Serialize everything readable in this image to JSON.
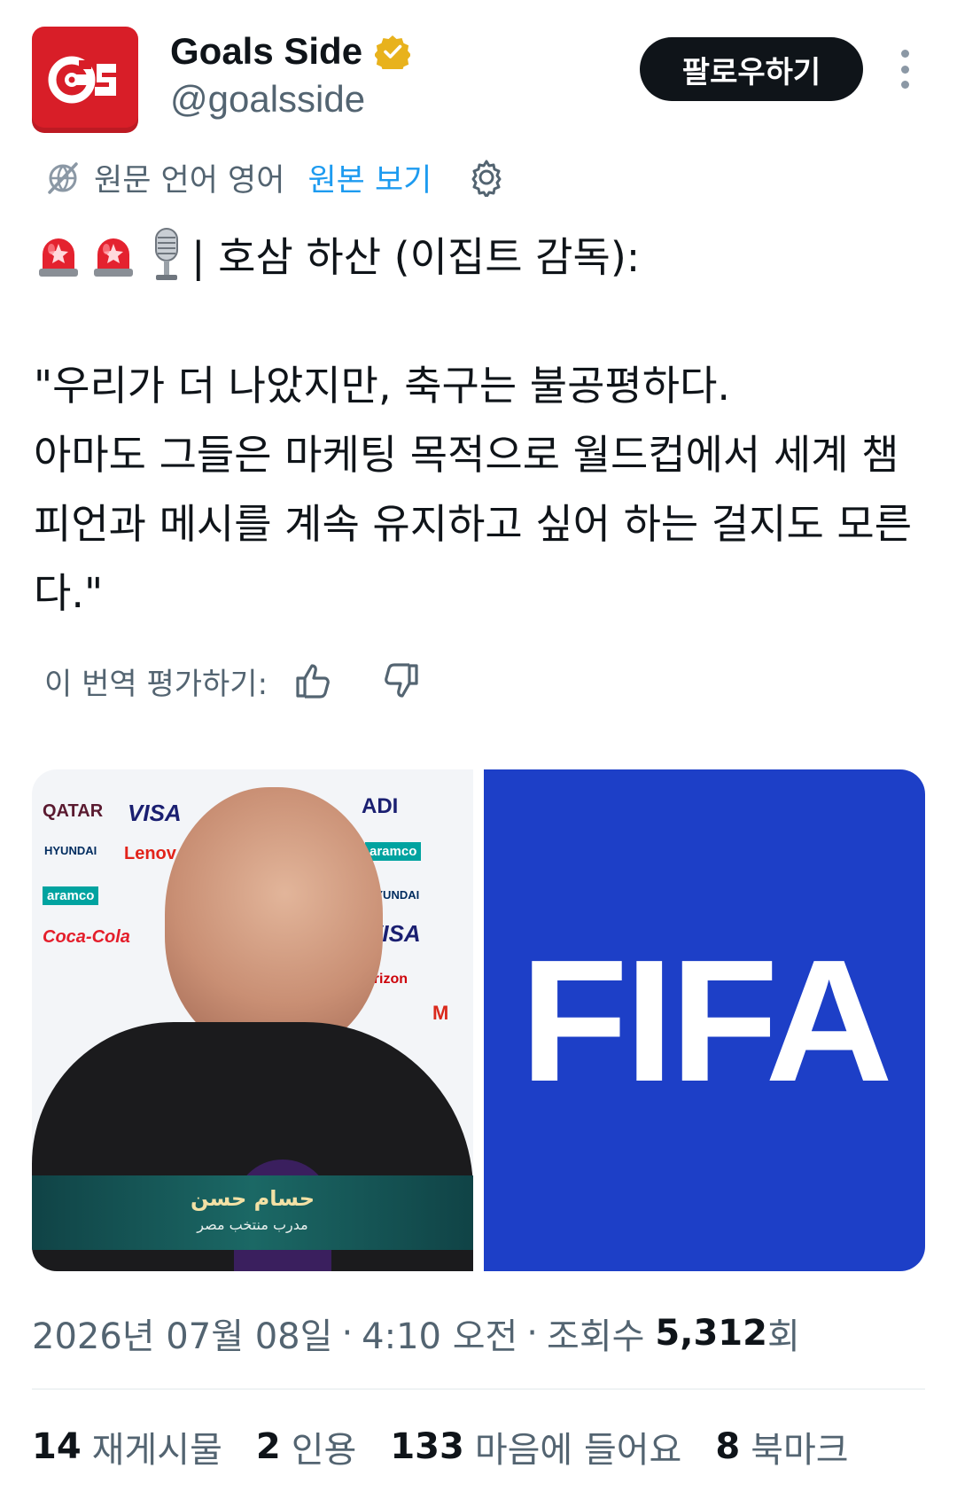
{
  "account": {
    "display_name": "Goals Side",
    "handle": "@goalsside",
    "verified_icon": "gold-verified-badge",
    "logo_text": "GS",
    "brand_color": "#d81e28"
  },
  "header": {
    "follow_label": "팔로우하기",
    "more_icon": "vertical-dots-icon"
  },
  "translation": {
    "source_label": "원문 언어 영어",
    "view_original_label": "원본 보기"
  },
  "tweet": {
    "line1": "| 호삼 하산 (이집트 감독):",
    "line1_emojis": [
      "siren",
      "siren",
      "microphone"
    ],
    "quote": "\"우리가 더 나았지만, 축구는 불공평하다.\n아마도 그들은 마케팅 목적으로 월드컵에서 세계 챔피언과 메시를 계속 유지하고 싶어 하는 걸지도 모른다.\""
  },
  "rating": {
    "label": "이 번역 평가하기:"
  },
  "media": {
    "left_caption_name": "حسام حسن",
    "left_caption_role": "مدرب منتخب مصر",
    "right_logo_text": "FIFA",
    "right_bg_color": "#1d3fc7"
  },
  "meta": {
    "date": "2026년 07월 08일",
    "time": "4:10 오전",
    "views_label": "조회수",
    "views_count": "5,312",
    "views_suffix": "회",
    "separator": "·"
  },
  "stats": [
    {
      "count": "14",
      "label": "재게시물"
    },
    {
      "count": "2",
      "label": "인용"
    },
    {
      "count": "133",
      "label": "마음에 들어요"
    },
    {
      "count": "8",
      "label": "북마크"
    }
  ],
  "colors": {
    "text": "#0f1419",
    "secondary": "#536471",
    "link": "#1d9bf0",
    "button_bg": "#0f1419"
  }
}
